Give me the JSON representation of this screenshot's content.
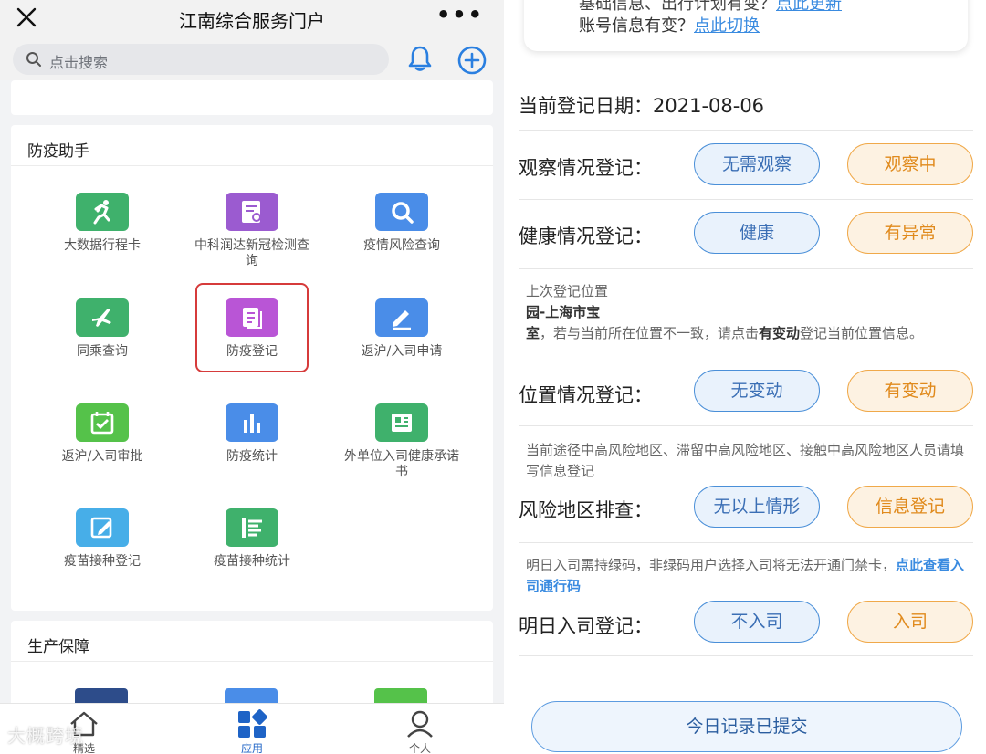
{
  "left": {
    "title": "江南综合服务门户",
    "more": "•••",
    "search_placeholder": "点击搜索",
    "section1": "防疫助手",
    "section2": "生产保障",
    "apps": [
      {
        "label": "大数据行程卡",
        "color": "#3fb16c"
      },
      {
        "label": "中科润达新冠检测查询",
        "color": "#9b5bd0"
      },
      {
        "label": "疫情风险查询",
        "color": "#4a8de8"
      },
      {
        "label": "同乘查询",
        "color": "#3fb16c"
      },
      {
        "label": "防疫登记",
        "color": "#b955d6"
      },
      {
        "label": "返沪/入司申请",
        "color": "#4a8de8"
      },
      {
        "label": "返沪/入司审批",
        "color": "#55c24a"
      },
      {
        "label": "防疫统计",
        "color": "#4a8de8"
      },
      {
        "label": "外单位入司健康承诺书",
        "color": "#3fb16c"
      },
      {
        "label": "疫苗接种登记",
        "color": "#47aee8"
      },
      {
        "label": "疫苗接种统计",
        "color": "#3fb16c"
      }
    ],
    "tabs": [
      {
        "label": "精选"
      },
      {
        "label": "应用"
      },
      {
        "label": "个人"
      }
    ],
    "watermark": "大概跨境"
  },
  "right": {
    "banner_line1_prefix": "基础信息、出行计划有变？",
    "banner_line1_link": "点此更新",
    "banner_line2_prefix": "账号信息有变？",
    "banner_line2_link": "点此切换",
    "date_label": "当前登记日期：",
    "date_value": "2021-08-06",
    "rows": [
      {
        "label": "观察情况登记：",
        "opt1": "无需观察",
        "opt2": "观察中"
      },
      {
        "label": "健康情况登记：",
        "opt1": "健康",
        "opt2": "有异常"
      },
      {
        "label": "位置情况登记：",
        "opt1": "无变动",
        "opt2": "有变动"
      },
      {
        "label": "风险地区排查：",
        "opt1": "无以上情形",
        "opt2": "信息登记"
      },
      {
        "label": "明日入司登记：",
        "opt1": "不入司",
        "opt2": "入司"
      }
    ],
    "location_note": {
      "line1": "上次登记位置",
      "loc_a": "园-上海市宝",
      "loc_b": "室",
      "text": "，若与当前所在位置不一致，请点击",
      "bold": "有变动",
      "text2": "登记当前位置信息。"
    },
    "risk_note": "当前途径中高风险地区、滞留中高风险地区、接触中高风险地区人员请填写信息登记",
    "entry_note": "明日入司需持绿码，非绿码用户选择入司将无法开通门禁卡，",
    "entry_link": "点此查看入司通行码",
    "submit": "今日记录已提交"
  }
}
